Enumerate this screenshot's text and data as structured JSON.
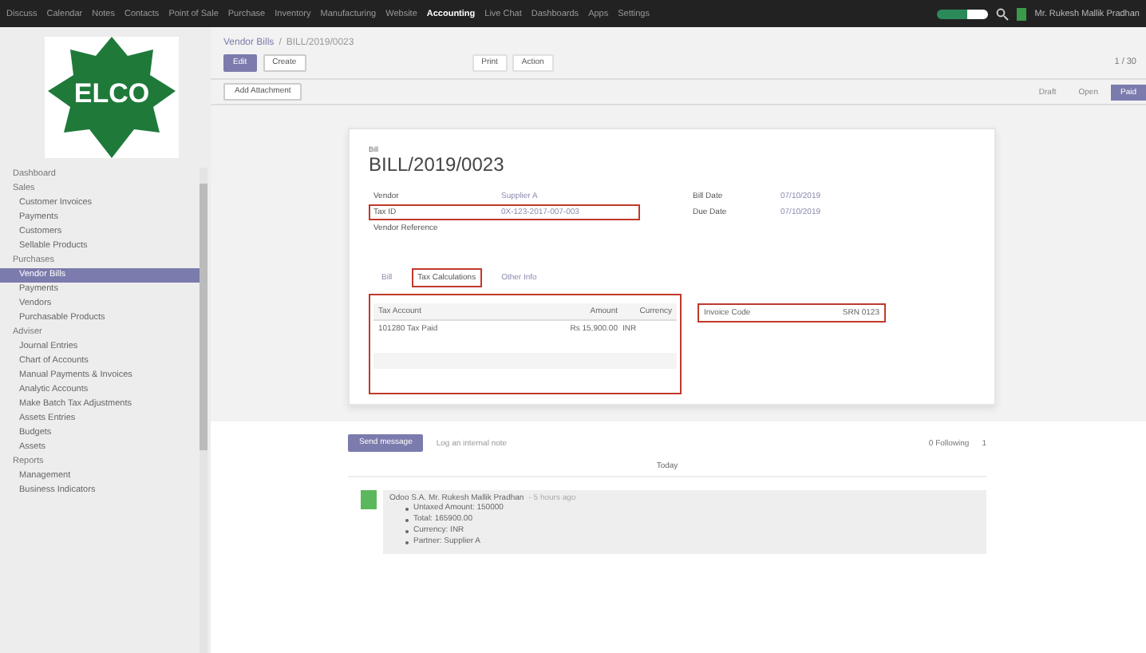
{
  "top_menu": [
    {
      "label": "Discuss",
      "selected": false
    },
    {
      "label": "Calendar",
      "selected": false
    },
    {
      "label": "Notes",
      "selected": false
    },
    {
      "label": "Contacts",
      "selected": false
    },
    {
      "label": "Point of Sale",
      "selected": false
    },
    {
      "label": "Purchase",
      "selected": false
    },
    {
      "label": "Inventory",
      "selected": false
    },
    {
      "label": "Manufacturing",
      "selected": false
    },
    {
      "label": "Website",
      "selected": false
    },
    {
      "label": "Accounting",
      "selected": true
    },
    {
      "label": "Live Chat",
      "selected": false
    },
    {
      "label": "Dashboards",
      "selected": false
    },
    {
      "label": "Apps",
      "selected": false
    },
    {
      "label": "Settings",
      "selected": false
    }
  ],
  "user": "Mr. Rukesh Mallik Pradhan",
  "logo_text": "ELCO",
  "sidebar": [
    {
      "label": "Dashboard",
      "kind": "header",
      "selected": false
    },
    {
      "label": "Sales",
      "kind": "header",
      "selected": false
    },
    {
      "label": "Customer Invoices",
      "kind": "item",
      "selected": false
    },
    {
      "label": "Payments",
      "kind": "item",
      "selected": false
    },
    {
      "label": "Customers",
      "kind": "item",
      "selected": false
    },
    {
      "label": "Sellable Products",
      "kind": "item",
      "selected": false
    },
    {
      "label": "Purchases",
      "kind": "header",
      "selected": false
    },
    {
      "label": "Vendor Bills",
      "kind": "item",
      "selected": true
    },
    {
      "label": "Payments",
      "kind": "item",
      "selected": false
    },
    {
      "label": "Vendors",
      "kind": "item",
      "selected": false
    },
    {
      "label": "Purchasable Products",
      "kind": "item",
      "selected": false
    },
    {
      "label": "Adviser",
      "kind": "header",
      "selected": false
    },
    {
      "label": "Journal Entries",
      "kind": "item",
      "selected": false
    },
    {
      "label": "Chart of Accounts",
      "kind": "item",
      "selected": false
    },
    {
      "label": "Manual Payments & Invoices",
      "kind": "item",
      "selected": false
    },
    {
      "label": "Analytic Accounts",
      "kind": "item",
      "selected": false
    },
    {
      "label": "Make Batch Tax Adjustments",
      "kind": "item",
      "selected": false
    },
    {
      "label": "Assets Entries",
      "kind": "item",
      "selected": false
    },
    {
      "label": "Budgets",
      "kind": "item",
      "selected": false
    },
    {
      "label": "Assets",
      "kind": "item",
      "selected": false
    },
    {
      "label": "Reports",
      "kind": "header",
      "selected": false
    },
    {
      "label": "Management",
      "kind": "item",
      "selected": false
    },
    {
      "label": "Business Indicators",
      "kind": "item",
      "selected": false
    }
  ],
  "breadcrumb": {
    "parent": "Vendor Bills",
    "separator": "/",
    "current": "BILL/2019/0023"
  },
  "stages": [
    {
      "label": "Draft",
      "selected": false
    },
    {
      "label": "Open",
      "selected": false
    },
    {
      "label": "Paid",
      "selected": true
    }
  ],
  "buttons": {
    "edit": "Edit",
    "create": "Create",
    "print": "Print",
    "action": "Action",
    "pager": "1 / 30",
    "attach": "Add Attachment"
  },
  "form": {
    "kind_label": "Bill",
    "number": "BILL/2019/0023",
    "left_fields": [
      {
        "label": "Vendor",
        "value": "Supplier A",
        "highlighted": false
      },
      {
        "label": "Tax ID",
        "value": "0X-123-2017-007-003",
        "highlighted": true
      },
      {
        "label": "Vendor Reference",
        "highlighted": false
      }
    ],
    "right_fields": [
      {
        "label": "Bill Date",
        "value": "07/10/2019"
      },
      {
        "label": "Due Date",
        "value": "07/10/2019"
      }
    ],
    "tabs": [
      {
        "label": "Bill",
        "selected": false,
        "highlighted": false
      },
      {
        "label": "Tax Calculations",
        "selected": true,
        "highlighted": true
      },
      {
        "label": "Other Info",
        "selected": false,
        "highlighted": false
      }
    ],
    "table": {
      "highlighted": true,
      "columns": [
        "Tax Account",
        "Amount",
        "Currency"
      ],
      "rows": [
        [
          "101280 Tax Paid",
          "Rs 15,900.00",
          "INR"
        ]
      ]
    },
    "code_box": {
      "label": "Invoice Code",
      "value": "SRN 0123",
      "highlighted": true
    }
  },
  "chatter": {
    "send": "Send message",
    "log": "Log an internal note",
    "following": "0 Following",
    "followers": "1",
    "day": "Today",
    "author": "Odoo S.A. Mr. Rukesh Mallik Pradhan",
    "time": "- 5 hours ago",
    "items": [
      "Untaxed Amount: 150000",
      "Total: 165900.00",
      "Currency: INR",
      "Partner: Supplier A"
    ]
  }
}
